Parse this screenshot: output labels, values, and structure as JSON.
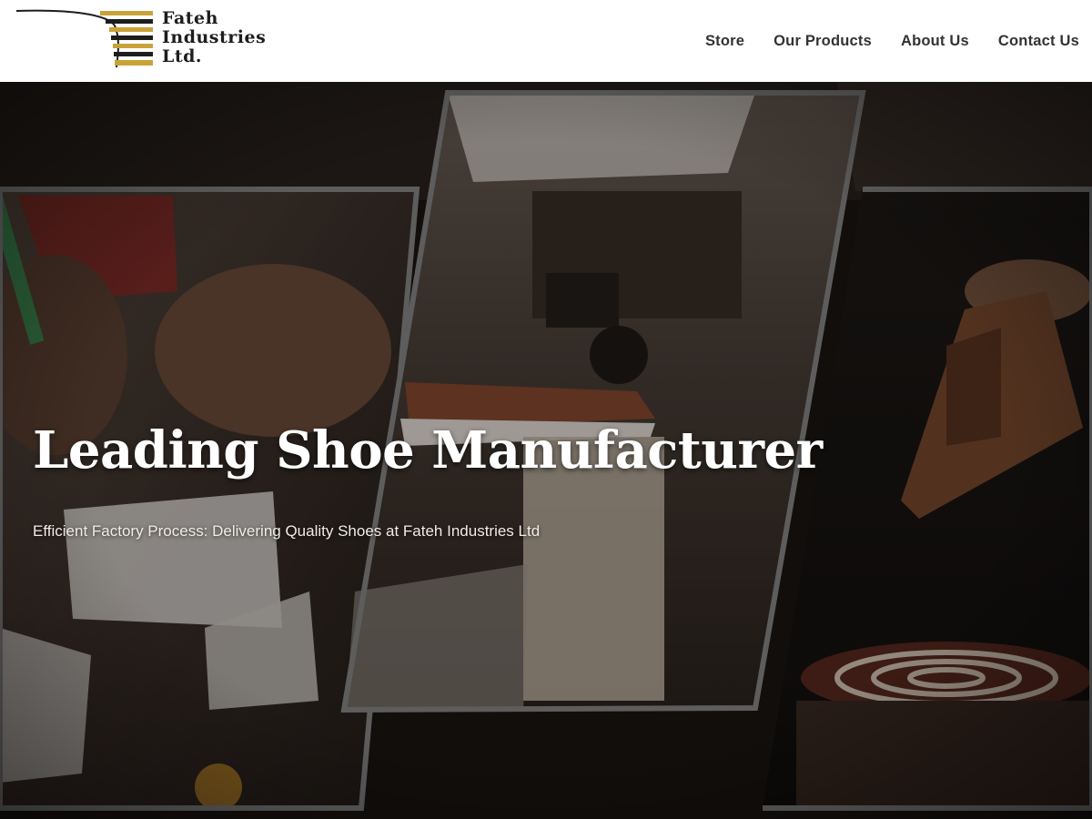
{
  "header": {
    "logo": {
      "line1": "Fateh",
      "line2": "Industries",
      "line3": "Ltd."
    },
    "nav": [
      {
        "label": "Store"
      },
      {
        "label": "Our Products"
      },
      {
        "label": "About Us"
      },
      {
        "label": "Contact Us"
      }
    ]
  },
  "hero": {
    "title": "Leading Shoe Manufacturer",
    "subtitle": "Efficient Factory Process: Delivering Quality Shoes at Fateh Industries Ltd"
  },
  "colors": {
    "logo_gold": "#c9a23a",
    "logo_dark": "#1d1d1d",
    "nav_text": "#333333",
    "hero_bg": "#1a1512",
    "panel_frame": "#8a8a8a"
  },
  "icons": {
    "logo": "gold-stripes-wing-logo"
  }
}
